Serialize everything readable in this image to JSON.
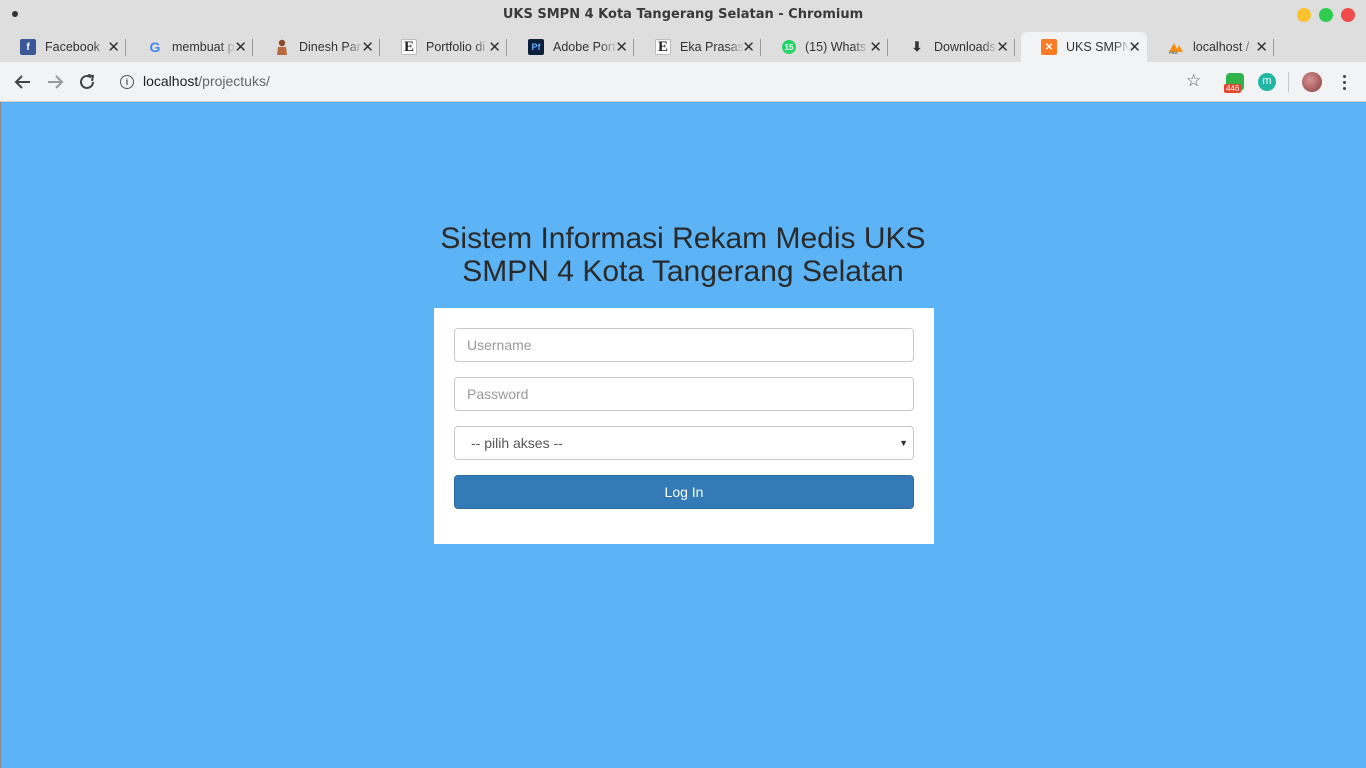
{
  "window": {
    "title": "UKS SMPN 4 Kota Tangerang Selatan - Chromium"
  },
  "tabs": [
    {
      "label": "Facebook",
      "icon": "facebook-icon",
      "color": "#3b5998",
      "glyph": "f"
    },
    {
      "label": "membuat p",
      "icon": "google-icon",
      "color": "#ffffff",
      "glyph": "G"
    },
    {
      "label": "Dinesh Par",
      "icon": "person-icon",
      "color": "#b86b3e",
      "glyph": ""
    },
    {
      "label": "Portfolio di",
      "icon": "envato-e-icon",
      "color": "#ffffff",
      "glyph": "E"
    },
    {
      "label": "Adobe Port",
      "icon": "adobe-portfolio-icon",
      "color": "#0b1f3a",
      "glyph": "Pf"
    },
    {
      "label": "Eka Prasas",
      "icon": "envato-e-icon",
      "color": "#ffffff",
      "glyph": "E"
    },
    {
      "label": "(15) Whats",
      "icon": "whatsapp-icon",
      "color": "#25d366",
      "glyph": "15"
    },
    {
      "label": "Downloads",
      "icon": "download-icon",
      "color": "#ffffff",
      "glyph": "⬇"
    },
    {
      "label": "UKS SMPN",
      "icon": "xampp-icon",
      "color": "#fb7a24",
      "glyph": "✕"
    },
    {
      "label": "localhost /",
      "icon": "phpmyadmin-icon",
      "color": "#ffffff",
      "glyph": "▲"
    }
  ],
  "address_bar": {
    "host": "localhost",
    "path": "/projectuks/"
  },
  "extensions": {
    "badge_count": "446",
    "ext2_letter": "m"
  },
  "page": {
    "heading_line1": "Sistem Informasi Rekam Medis UKS",
    "heading_line2": "SMPN 4 Kota Tangerang Selatan",
    "username_placeholder": "Username",
    "password_placeholder": "Password",
    "akses_selected": "-- pilih akses --",
    "login_label": "Log In"
  },
  "colors": {
    "background": "#5cb3f6",
    "button": "#337ab7"
  }
}
